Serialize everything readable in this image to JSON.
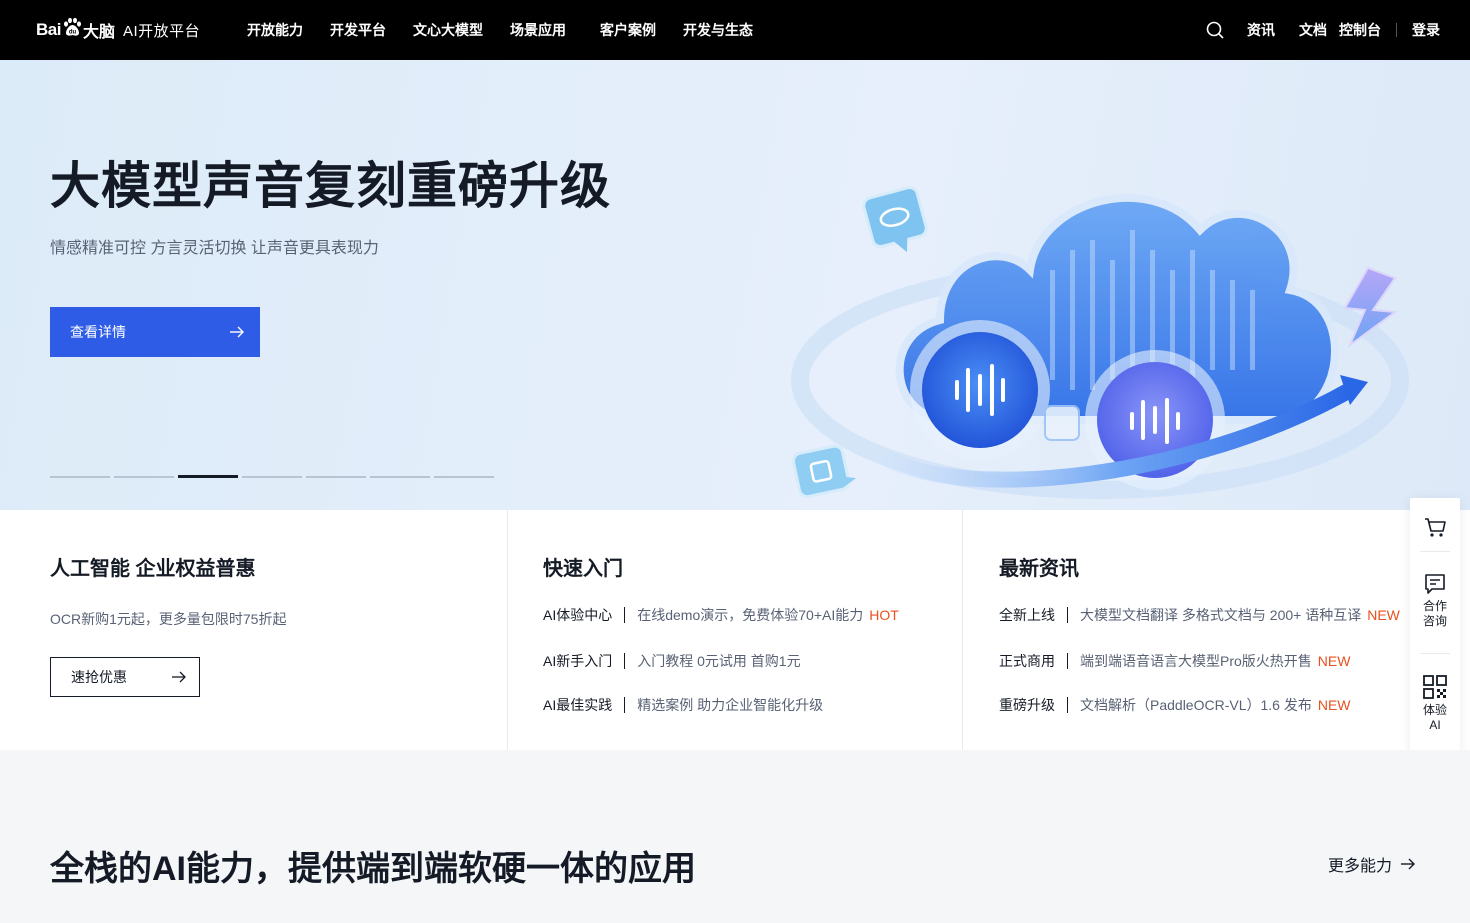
{
  "nav": {
    "logo_bai": "Bai",
    "logo_cn": "大脑",
    "logo_platform": "AI开放平台",
    "items": [
      "开放能力",
      "开发平台",
      "文心大模型",
      "场景应用",
      "客户案例",
      "开发与生态"
    ],
    "right": {
      "news": "资讯",
      "docs": "文档",
      "console": "控制台",
      "login": "登录"
    }
  },
  "hero": {
    "title": "大模型声音复刻重磅升级",
    "subtitle": "情感精准可控 方言灵活切换 让声音更具表现力",
    "button": "查看详情",
    "slides_total": 7,
    "active_slide": 3
  },
  "card1": {
    "title": "人工智能 企业权益普惠",
    "desc": "OCR新购1元起，更多量包限时75折起",
    "button": "速抢优惠"
  },
  "card2": {
    "title": "快速入门",
    "rows": [
      {
        "k": "AI体验中心",
        "v": "在线demo演示，免费体验70+AI能力",
        "tag": "HOT"
      },
      {
        "k": "AI新手入门",
        "v": "入门教程 0元试用 首购1元",
        "tag": ""
      },
      {
        "k": "AI最佳实践",
        "v": "精选案例 助力企业智能化升级",
        "tag": ""
      }
    ]
  },
  "card3": {
    "title": "最新资讯",
    "rows": [
      {
        "k": "全新上线",
        "v": "大模型文档翻译 多格式文档与 200+ 语种互译",
        "tag": "NEW"
      },
      {
        "k": "正式商用",
        "v": "端到端语音语言大模型Pro版火热开售",
        "tag": "NEW"
      },
      {
        "k": "重磅升级",
        "v": "文档解析（PaddleOCR-VL）1.6 发布",
        "tag": "NEW"
      }
    ]
  },
  "float": {
    "consult_1": "合作",
    "consult_2": "咨询",
    "try_1": "体验",
    "try_2": "AI"
  },
  "bottom": {
    "title": "全栈的AI能力，提供端到端软硬一体的应用",
    "more": "更多能力"
  },
  "colors": {
    "nav_bg": "#000000",
    "primary": "#2e5ce6",
    "tag": "#e8501e",
    "text": "#151b26",
    "muted": "#596275"
  }
}
